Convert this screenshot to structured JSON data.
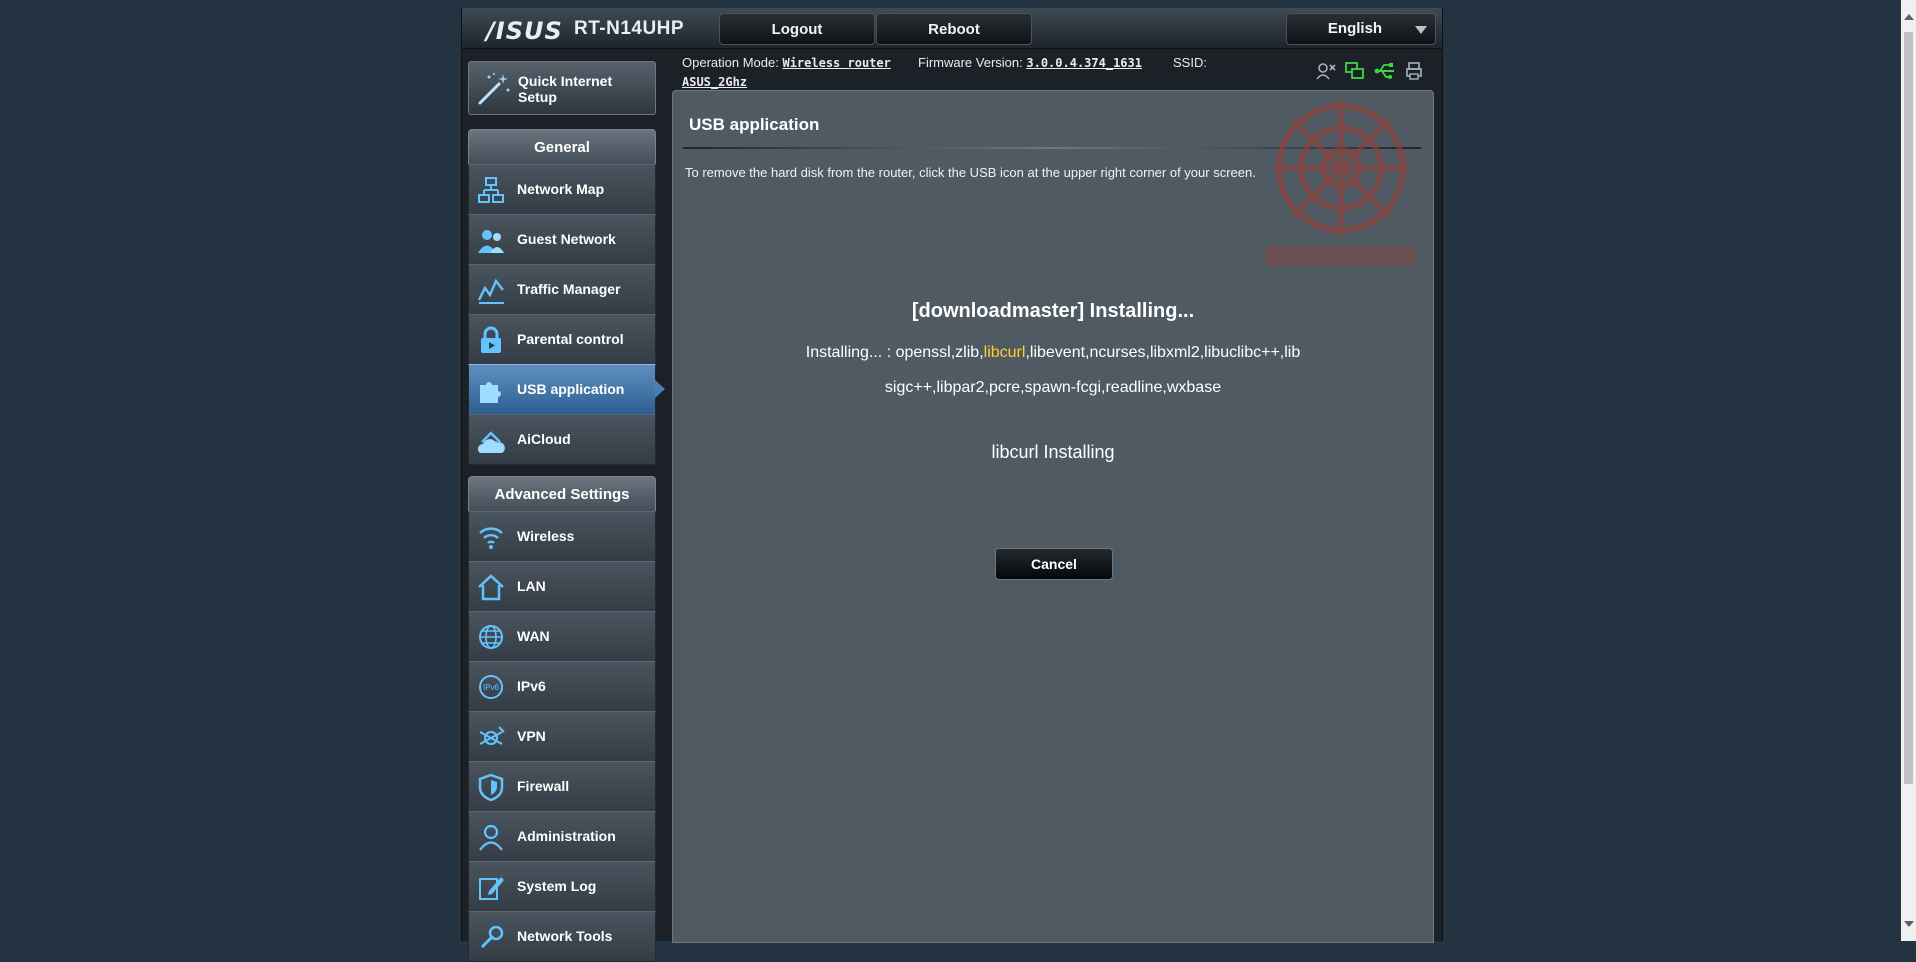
{
  "header": {
    "brand": "/ISUS",
    "model": "RT-N14UHP",
    "logout_label": "Logout",
    "reboot_label": "Reboot",
    "language": "English"
  },
  "status": {
    "mode_label": "Operation Mode:",
    "mode_value": "Wireless router",
    "firmware_label": "Firmware Version:",
    "firmware_value": "3.0.0.4.374_1631",
    "ssid_label": "SSID:",
    "ssid_value": "ASUS_2Ghz",
    "icons": [
      "user-icon",
      "network-icon",
      "usb-icon",
      "printer-icon"
    ]
  },
  "sidebar": {
    "quick_setup": "Quick Internet Setup",
    "general_title": "General",
    "general_items": [
      {
        "label": "Network Map",
        "icon": "network-map-icon"
      },
      {
        "label": "Guest Network",
        "icon": "guest-network-icon"
      },
      {
        "label": "Traffic Manager",
        "icon": "traffic-manager-icon"
      },
      {
        "label": "Parental control",
        "icon": "lock-icon"
      },
      {
        "label": "USB application",
        "icon": "puzzle-icon",
        "active": true
      },
      {
        "label": "AiCloud",
        "icon": "cloud-house-icon"
      }
    ],
    "advanced_title": "Advanced Settings",
    "advanced_items": [
      {
        "label": "Wireless",
        "icon": "wifi-icon"
      },
      {
        "label": "LAN",
        "icon": "house-icon"
      },
      {
        "label": "WAN",
        "icon": "globe-icon"
      },
      {
        "label": "IPv6",
        "icon": "ipv6-globe-icon"
      },
      {
        "label": "VPN",
        "icon": "vpn-icon"
      },
      {
        "label": "Firewall",
        "icon": "shield-icon"
      },
      {
        "label": "Administration",
        "icon": "admin-user-icon"
      },
      {
        "label": "System Log",
        "icon": "log-edit-icon"
      },
      {
        "label": "Network Tools",
        "icon": "tools-icon"
      }
    ]
  },
  "main": {
    "title": "USB application",
    "description": "To remove the hard disk from the router, click the USB icon at the upper right corner of your screen.",
    "install_heading": "[downloadmaster] Installing...",
    "packages_prefix": "Installing... : openssl,zlib,",
    "packages_highlight": "libcurl",
    "packages_suffix": ",libevent,ncurses,libxml2,libuclibc++,libsigc++,libpar2,pcre,spawn-fcgi,readline,wxbase",
    "status_text": "libcurl Installing",
    "cancel_label": "Cancel"
  },
  "colors": {
    "highlight": "#ffd12a",
    "panel_bg": "#4f5a63",
    "page_bg": "#233342",
    "active_nav": "#3f75a8"
  }
}
